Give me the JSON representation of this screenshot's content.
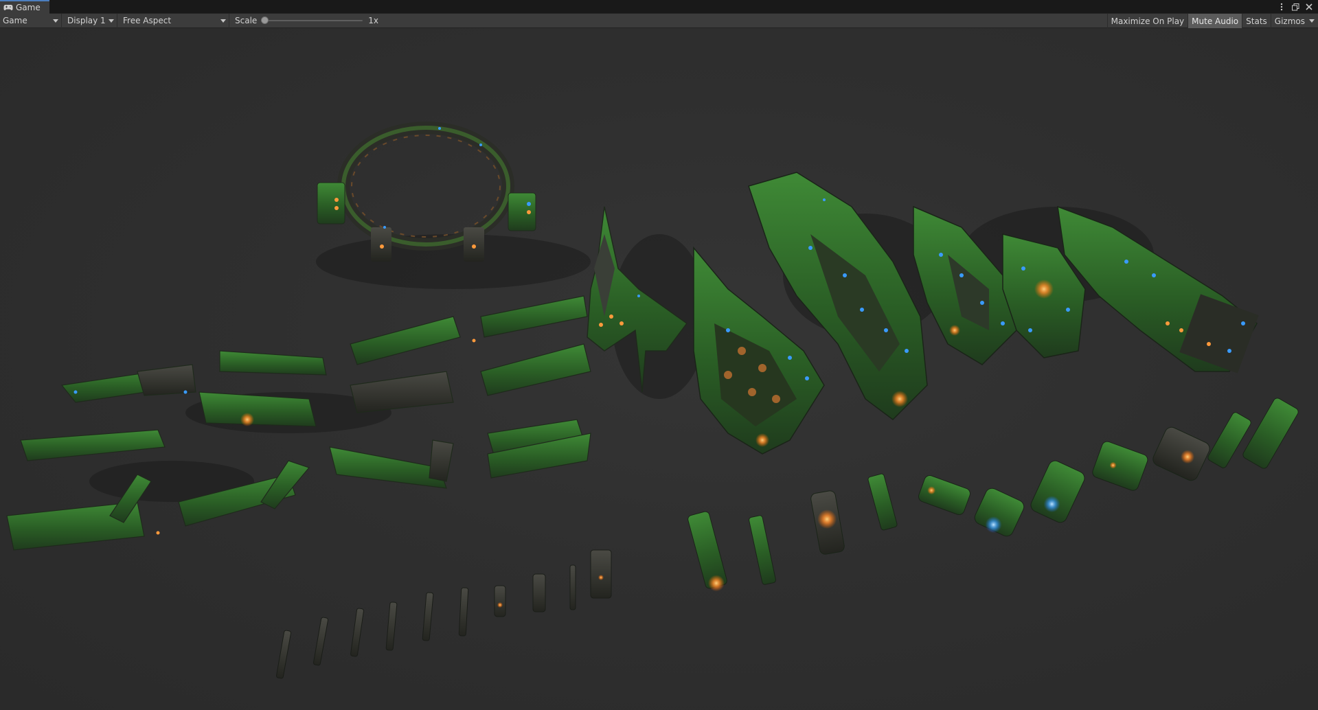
{
  "window": {
    "tab_title": "Game",
    "tab_icon": "gamepad-icon",
    "controls": [
      "more-options-icon",
      "maximize-icon",
      "close-icon"
    ]
  },
  "toolbar": {
    "view_mode": "Game",
    "display": "Display 1",
    "aspect": "Free Aspect",
    "scale_label": "Scale",
    "scale_value": "1x",
    "maximize_on_play": "Maximize On Play",
    "mute_audio": "Mute Audio",
    "stats": "Stats",
    "gizmos": "Gizmos"
  },
  "states": {
    "mute_audio_active": true,
    "maximize_on_play_active": false
  },
  "colors": {
    "accent_tab": "#4c7fbf",
    "hull_green": "#2f6b2a",
    "hull_dark": "#3a3f37",
    "engine_orange": "#ff9a3c",
    "light_blue": "#3a9bff",
    "viewport_bg": "#2f2f2f"
  }
}
